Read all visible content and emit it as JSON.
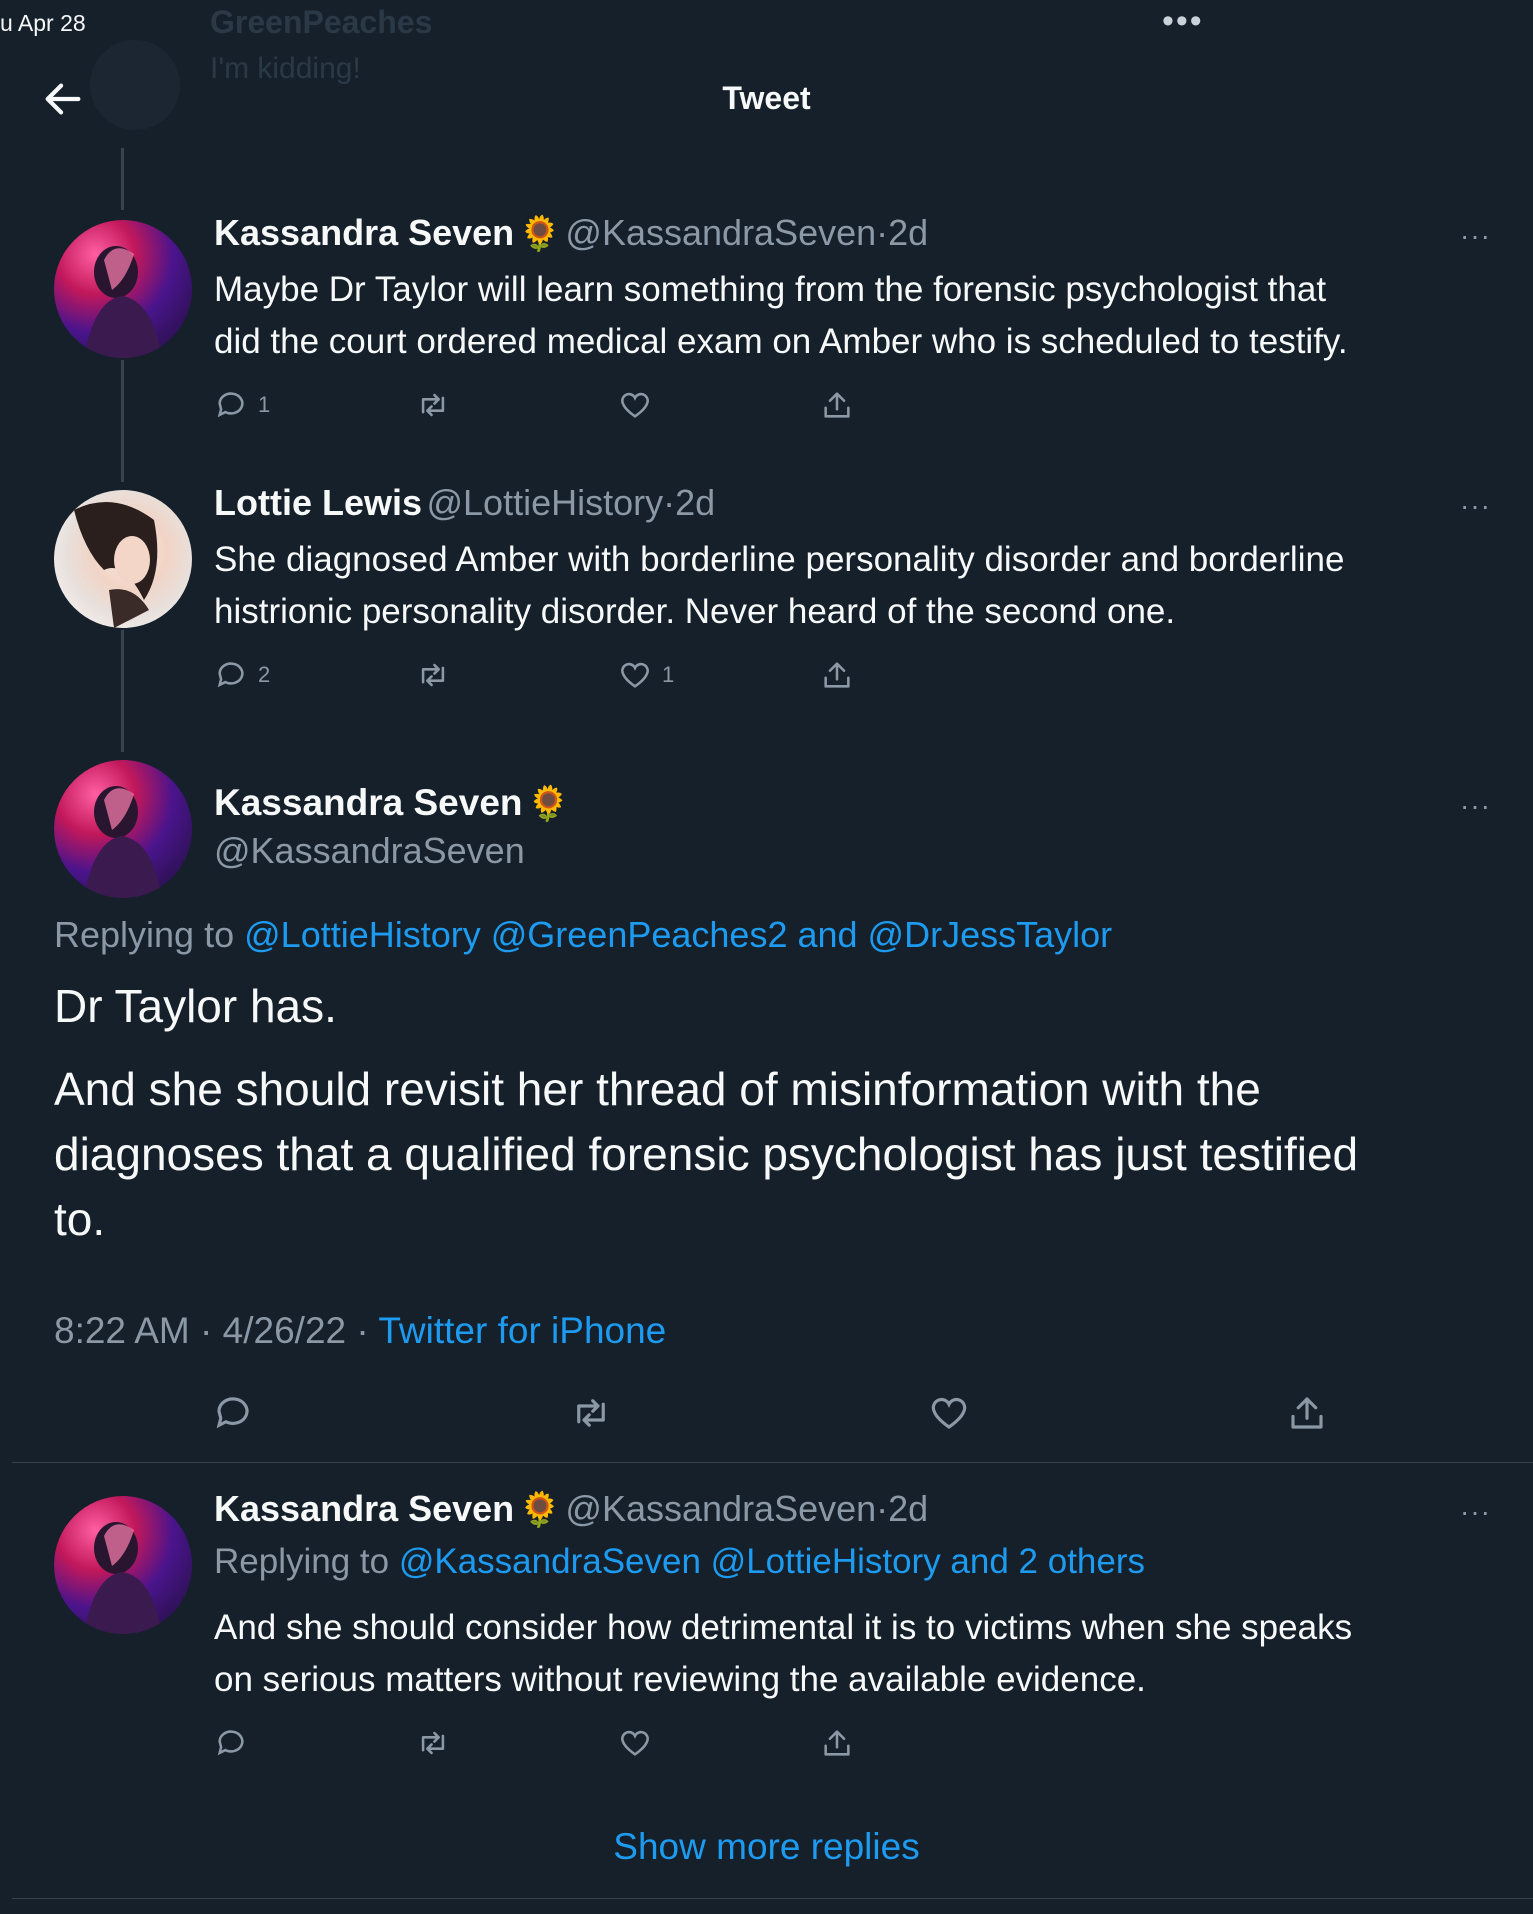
{
  "status": {
    "date": "u Apr 28",
    "dots": "•••"
  },
  "background_ghost": {
    "name": "GreenPeaches",
    "sub": "I'm kidding!"
  },
  "header": {
    "title": "Tweet",
    "back_icon": "arrow-left-icon"
  },
  "colors": {
    "background": "#15202b",
    "accent": "#1d9bf0",
    "muted": "#8b98a5",
    "divider": "#38444d"
  },
  "tweets": [
    {
      "name": "Kassandra Seven",
      "emoji": "🌻",
      "handle": "@KassandraSeven",
      "sep": "·",
      "time": "2d",
      "text_line1": "Maybe Dr Taylor will learn something from the forensic psychologist that",
      "text_line2": "did the court ordered medical exam on Amber who is scheduled to testify.",
      "replies": "1",
      "retweets": "",
      "likes": ""
    },
    {
      "name": "Lottie Lewis",
      "handle": "@LottieHistory",
      "sep": "·",
      "time": "2d",
      "text_line1": "She diagnosed Amber with borderline personality disorder and borderline",
      "text_line2": "histrionic personality disorder. Never heard of the second one.",
      "replies": "2",
      "retweets": "",
      "likes": "1"
    }
  ],
  "main_tweet": {
    "name": "Kassandra Seven",
    "emoji": "🌻",
    "handle": "@KassandraSeven",
    "replying_prefix": "Replying to",
    "replying_to": "@LottieHistory @GreenPeaches2 and @DrJessTaylor",
    "para1": "Dr Taylor has.",
    "para2_line1": "And she should revisit her thread of misinformation with the",
    "para2_line2": "diagnoses that a qualified forensic psychologist has just testified",
    "para2_line3": "to.",
    "time": "8:22 AM",
    "date": "4/26/22",
    "sep": "·",
    "source": "Twitter for iPhone"
  },
  "reply": {
    "name": "Kassandra Seven",
    "emoji": "🌻",
    "handle": "@KassandraSeven",
    "sep": "·",
    "time": "2d",
    "replying_prefix": "Replying to",
    "replying_to": "@KassandraSeven @LottieHistory and 2 others",
    "text_line1": "And she should consider how detrimental it is to victims when she speaks",
    "text_line2": "on serious matters without reviewing the available evidence."
  },
  "more_label": "···",
  "show_more": "Show more replies"
}
